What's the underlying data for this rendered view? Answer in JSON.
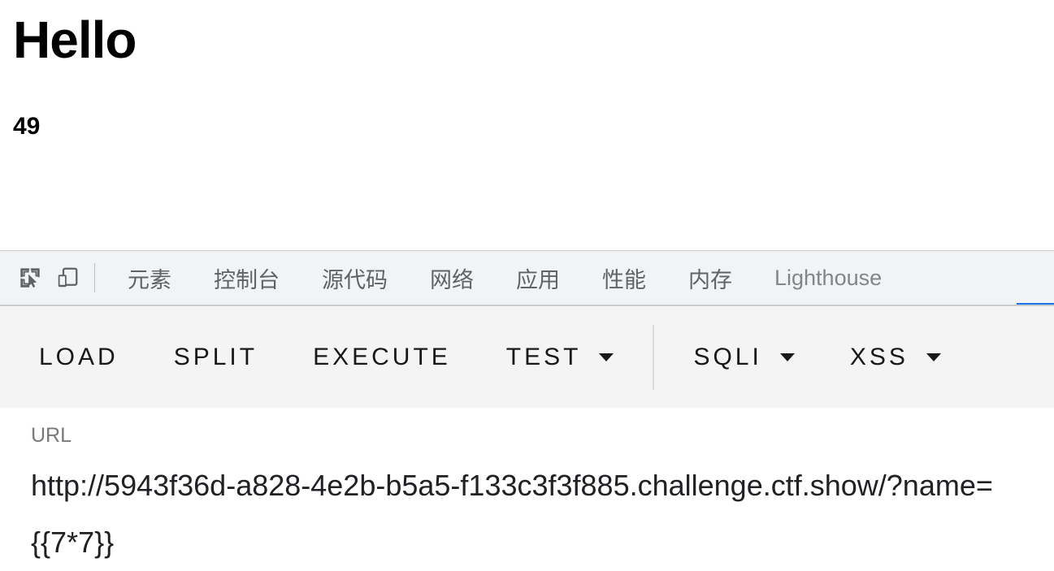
{
  "page": {
    "heading": "Hello",
    "value": "49"
  },
  "devtools": {
    "icons": {
      "inspect": "inspect-element-icon",
      "device": "device-toolbar-icon"
    },
    "tabs": [
      {
        "label": "元素",
        "active": false
      },
      {
        "label": "控制台",
        "active": false
      },
      {
        "label": "源代码",
        "active": false
      },
      {
        "label": "网络",
        "active": false
      },
      {
        "label": "应用",
        "active": false
      },
      {
        "label": "性能",
        "active": false
      },
      {
        "label": "内存",
        "active": false
      },
      {
        "label": "Lighthouse",
        "active": false
      }
    ],
    "active_tab_accent": "#1a73e8",
    "toolbar": {
      "buttons": [
        {
          "label": "LOAD",
          "caret": false
        },
        {
          "label": "SPLIT",
          "caret": false
        },
        {
          "label": "EXECUTE",
          "caret": false
        },
        {
          "label": "TEST",
          "caret": true
        },
        {
          "label": "SQLI",
          "caret": true
        },
        {
          "label": "XSS",
          "caret": true
        }
      ]
    },
    "url_field": {
      "label": "URL",
      "value": "http://5943f36d-a828-4e2b-b5a5-f133c3f3f885.challenge.ctf.show/?name={{7*7}}"
    }
  }
}
